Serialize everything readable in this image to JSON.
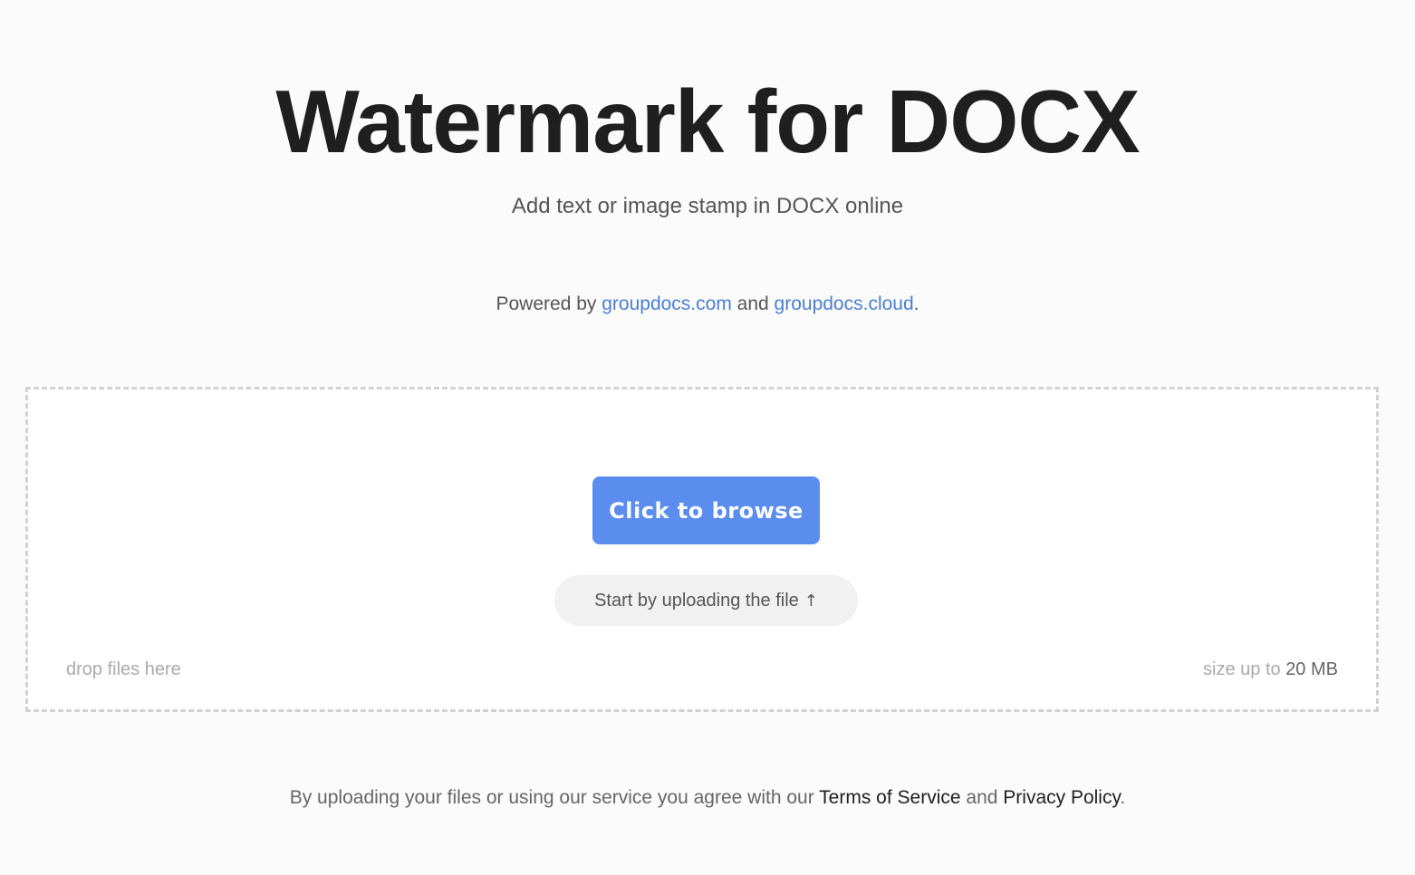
{
  "header": {
    "title": "Watermark for DOCX",
    "subtitle": "Add text or image stamp in DOCX online"
  },
  "powered_by": {
    "prefix": "Powered by",
    "link1": "groupdocs.com",
    "connector": "and",
    "link2": "groupdocs.cloud",
    "suffix": "."
  },
  "dropzone": {
    "browse_label": "Click to browse",
    "hint": "Start by uploading the file",
    "hint_icon": "arrow-up-icon",
    "hint_arrow": "↑",
    "drop_label": "drop files here",
    "size_prefix": "size up to",
    "size_value": "20 MB"
  },
  "footer": {
    "prefix": "By uploading your files or using our service you agree with our",
    "terms": "Terms of Service",
    "connector": "and",
    "privacy": "Privacy Policy",
    "suffix": "."
  },
  "colors": {
    "accent": "#5b8def",
    "link": "#4a7fd4",
    "background": "#fbfbfb"
  }
}
